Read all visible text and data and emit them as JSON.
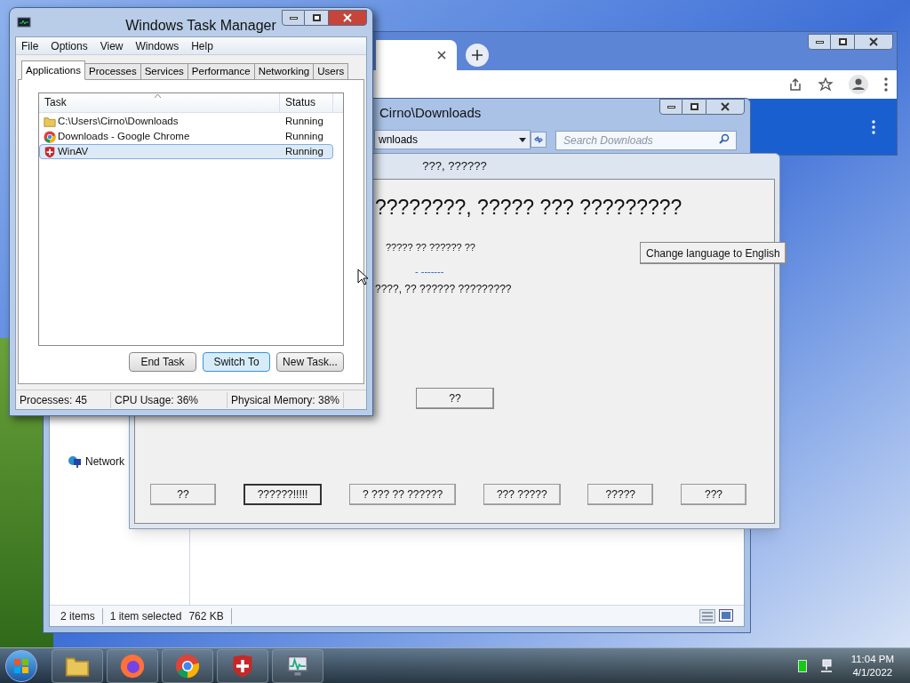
{
  "explorer": {
    "title": "Cirno\\Downloads",
    "address": "wnloads",
    "search": {
      "placeholder": "Search Downloads"
    },
    "nav_items": [
      {
        "label": "Network"
      }
    ],
    "status": {
      "count": "2 items",
      "selection": "1 item selected",
      "size": "762 KB"
    }
  },
  "dialog": {
    "title": "???, ??????",
    "heading": "????????, ????? ??? ?????????",
    "line_1": "????? ?? ?????? ??",
    "link": "- -------",
    "line_2": "????, ?? ?????? ?????????",
    "language_button": "Change language to English",
    "center_button": "??",
    "buttons": [
      {
        "label": "??",
        "focused": false
      },
      {
        "label": "??????!!!!!",
        "focused": true
      },
      {
        "label": "? ??? ?? ??????",
        "focused": false
      },
      {
        "label": "??? ?????",
        "focused": false
      },
      {
        "label": "?????",
        "focused": false
      },
      {
        "label": "???",
        "focused": false
      }
    ]
  },
  "task_manager": {
    "title": "Windows Task Manager",
    "menu": [
      "File",
      "Options",
      "View",
      "Windows",
      "Help"
    ],
    "tabs": [
      {
        "label": "Applications",
        "selected": true
      },
      {
        "label": "Processes",
        "selected": false
      },
      {
        "label": "Services",
        "selected": false
      },
      {
        "label": "Performance",
        "selected": false
      },
      {
        "label": "Networking",
        "selected": false
      },
      {
        "label": "Users",
        "selected": false
      }
    ],
    "columns": [
      "Task",
      "Status"
    ],
    "rows": [
      {
        "kind": "folder",
        "task": "C:\\Users\\Cirno\\Downloads",
        "status": "Running",
        "selected": false
      },
      {
        "kind": "browser",
        "task": "Downloads - Google Chrome",
        "status": "Running",
        "selected": false
      },
      {
        "kind": "shield",
        "task": "WinAV",
        "status": "Running",
        "selected": true
      }
    ],
    "buttons": [
      {
        "label": "End Task",
        "focused": false
      },
      {
        "label": "Switch To",
        "focused": true
      },
      {
        "label": "New Task...",
        "focused": false
      }
    ],
    "status": [
      "Processes: 45",
      "CPU Usage: 36%",
      "Physical Memory: 38%"
    ]
  },
  "taskbar": {
    "apps": [
      {
        "kind": "folder"
      },
      {
        "kind": "firefox"
      },
      {
        "kind": "browser"
      },
      {
        "kind": "shield"
      },
      {
        "kind": "monitor"
      }
    ],
    "time": "11:04 PM",
    "date": "4/1/2022"
  }
}
